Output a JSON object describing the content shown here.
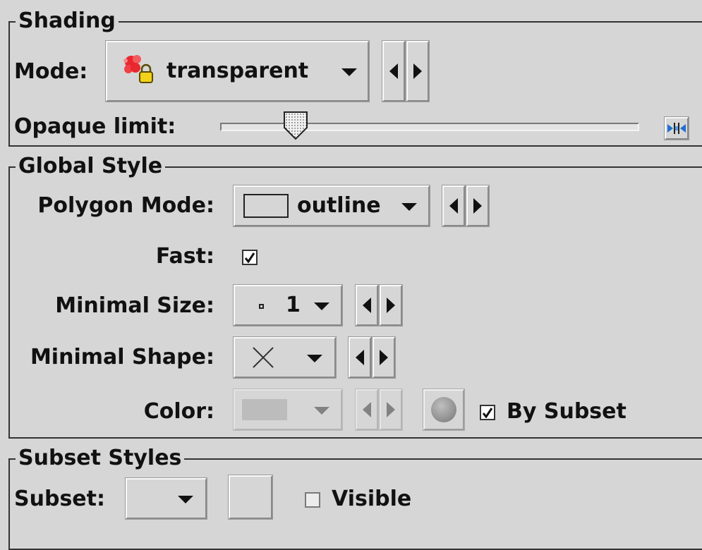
{
  "shading": {
    "title": "Shading",
    "mode_label": "Mode:",
    "mode_value": "transparent",
    "opaque_limit_label": "Opaque limit:",
    "opaque_limit_fraction": 0.16
  },
  "global_style": {
    "title": "Global Style",
    "polygon_mode_label": "Polygon Mode:",
    "polygon_mode_value": "outline",
    "fast_label": "Fast:",
    "fast_checked": true,
    "minimal_size_label": "Minimal Size:",
    "minimal_size_value": "1",
    "minimal_shape_label": "Minimal Shape:",
    "minimal_shape_icon": "cross-icon",
    "color_label": "Color:",
    "by_subset_label": "By Subset",
    "by_subset_checked": true
  },
  "subset_styles": {
    "title": "Subset Styles",
    "subset_label": "Subset:",
    "subset_value": "",
    "visible_label": "Visible",
    "visible_checked": false
  },
  "colors": {
    "background": "#d6d6d6",
    "shade_icon_red": "#e8282e",
    "lock_yellow": "#f2d21a"
  }
}
